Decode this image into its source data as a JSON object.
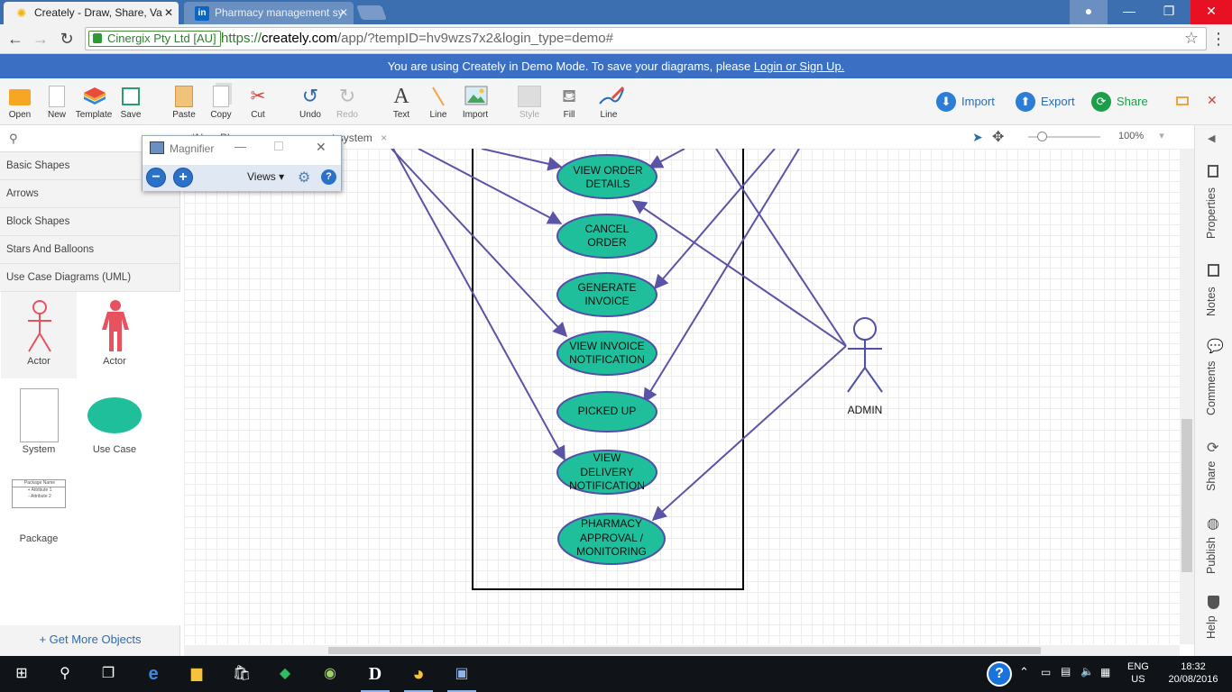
{
  "browser": {
    "tabs": [
      {
        "title": "Creately - Draw, Share, Va",
        "active": true
      },
      {
        "title": "Pharmacy management sy",
        "active": false
      }
    ],
    "secure_label": "Cinergix Pty Ltd [AU]",
    "url_scheme": "https://",
    "url_host": "creately.com",
    "url_rest": "/app/?tempID=hv9wzs7x2&login_type=demo#"
  },
  "banner": {
    "text": "You are using Creately in Demo Mode. To save your diagrams, please ",
    "link": "Login or Sign Up."
  },
  "toolbar": {
    "open": "Open",
    "new": "New",
    "template": "Template",
    "save": "Save",
    "paste": "Paste",
    "copy": "Copy",
    "cut": "Cut",
    "undo": "Undo",
    "redo": "Redo",
    "text": "Text",
    "line": "Line",
    "import": "Import",
    "style": "Style",
    "fill": "Fill",
    "line2": "Line",
    "import_btn": "Import",
    "export_btn": "Export",
    "share_btn": "Share"
  },
  "leftpanel": {
    "categories": [
      "Basic Shapes",
      "Arrows",
      "Block Shapes",
      "Stars And Balloons",
      "Use Case Diagrams (UML)"
    ],
    "shapes": [
      "Actor",
      "Actor",
      "System",
      "Use Case",
      "Package"
    ],
    "package_title": "Package Name",
    "package_attr1": "+ Attribute 1",
    "package_attr2": "- Attribute 2",
    "get_more": "+ Get More Objects"
  },
  "magnifier": {
    "title": "Magnifier",
    "views": "Views"
  },
  "canvas": {
    "doc_tab": "*New Pharmacy management system",
    "zoom": "100%",
    "usecases": [
      "VIEW ORDER DETAILS",
      "CANCEL ORDER",
      "GENERATE INVOICE",
      "VIEW INVOICE NOTIFICATION",
      "PICKED UP",
      "VIEW DELIVERY NOTIFICATION",
      "PHARMACY APPROVAL / MONITORING"
    ],
    "actor": "ADMIN"
  },
  "rightbar": {
    "properties": "Properties",
    "notes": "Notes",
    "comments": "Comments",
    "share": "Share",
    "publish": "Publish",
    "help": "Help"
  },
  "taskbar": {
    "lang": "ENG",
    "region": "US",
    "time": "18:32",
    "date": "20/08/2016"
  },
  "colors": {
    "usecase_fill": "#1fbf9c",
    "usecase_stroke": "#5050a8",
    "link_blue": "#2b6cb0",
    "banner": "#3a6fc4"
  }
}
